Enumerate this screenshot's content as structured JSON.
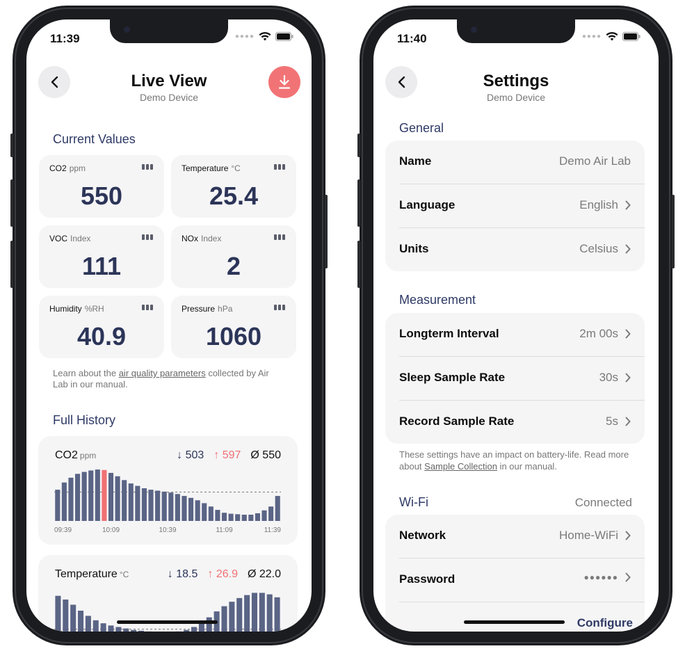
{
  "left": {
    "status_time": "11:39",
    "title": "Live View",
    "subtitle": "Demo Device",
    "section_current": "Current Values",
    "tiles": [
      {
        "label": "CO2",
        "unit": "ppm",
        "value": "550"
      },
      {
        "label": "Temperature",
        "unit": "°C",
        "value": "25.4"
      },
      {
        "label": "VOC",
        "unit": "Index",
        "value": "111"
      },
      {
        "label": "NOx",
        "unit": "Index",
        "value": "2"
      },
      {
        "label": "Humidity",
        "unit": "%RH",
        "value": "40.9"
      },
      {
        "label": "Pressure",
        "unit": "hPa",
        "value": "1060"
      }
    ],
    "note_pre": "Learn about the ",
    "note_link": "air quality parameters",
    "note_post": " collected by Air Lab in our manual.",
    "section_history": "Full History",
    "co2_card": {
      "title": "CO2",
      "unit": "ppm",
      "min": "↓ 503",
      "max": "↑ 597",
      "avg": "Ø 550"
    },
    "temp_card": {
      "title": "Temperature",
      "unit": "°C",
      "min": "↓ 18.5",
      "max": "↑ 26.9",
      "avg": "Ø 22.0"
    }
  },
  "right": {
    "status_time": "11:40",
    "title": "Settings",
    "subtitle": "Demo Device",
    "general_header": "General",
    "general_rows": [
      {
        "label": "Name",
        "value": "Demo Air Lab"
      },
      {
        "label": "Language",
        "value": "English"
      },
      {
        "label": "Units",
        "value": "Celsius"
      }
    ],
    "measurement_header": "Measurement",
    "measurement_rows": [
      {
        "label": "Longterm Interval",
        "value": "2m 00s"
      },
      {
        "label": "Sleep Sample Rate",
        "value": "30s"
      },
      {
        "label": "Record Sample Rate",
        "value": "5s"
      }
    ],
    "note_pre": "These settings have an impact on battery-life. Read more about ",
    "note_link": "Sample Collection",
    "note_post": " in our manual.",
    "wifi_header": "Wi-Fi",
    "wifi_status": "Connected",
    "wifi_rows": [
      {
        "label": "Network",
        "value": "Home-WiFi"
      },
      {
        "label": "Password",
        "value": "●●●●●●"
      }
    ],
    "configure": "Configure"
  },
  "chart_data": [
    {
      "type": "bar",
      "title": "CO2",
      "unit": "ppm",
      "x_ticks": [
        "09:39",
        "10:09",
        "10:39",
        "11:09",
        "11:39"
      ],
      "values": [
        555,
        570,
        580,
        588,
        592,
        595,
        597,
        596,
        590,
        583,
        575,
        568,
        563,
        558,
        555,
        553,
        551,
        549,
        546,
        542,
        538,
        533,
        527,
        520,
        513,
        507,
        505,
        504,
        503,
        503,
        506,
        512,
        520,
        542
      ],
      "highlight_index": 7,
      "avg": 550,
      "ylim": [
        490,
        600
      ],
      "bar_color": "#5a6485",
      "highlight_color": "#f07174"
    },
    {
      "type": "bar",
      "title": "Temperature",
      "unit": "°C",
      "values": [
        26.5,
        26.0,
        25.3,
        24.5,
        23.8,
        23.2,
        22.8,
        22.5,
        22.3,
        22.1,
        21.9,
        21.8,
        21.7,
        21.6,
        21.6,
        21.6,
        21.7,
        21.9,
        22.3,
        22.9,
        23.6,
        24.4,
        25.1,
        25.7,
        26.2,
        26.6,
        26.9,
        26.9,
        26.7,
        26.3
      ],
      "avg": 22.0,
      "ylim": [
        17,
        27.5
      ],
      "bar_color": "#5a6485"
    }
  ]
}
